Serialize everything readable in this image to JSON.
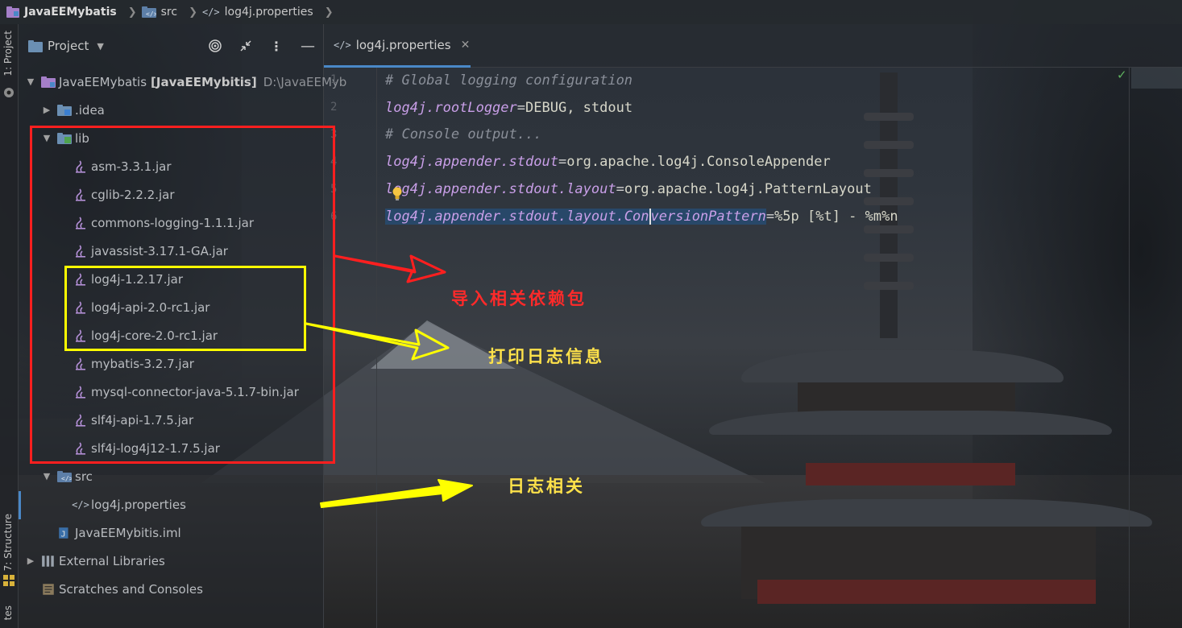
{
  "navbar": {
    "project": "JavaEEMybatis",
    "src": "src",
    "file": "log4j.properties"
  },
  "stripe": {
    "project_label": "1: Project",
    "structure_label": "7: Structure",
    "favorites_label": "tes"
  },
  "panel": {
    "title": "Project"
  },
  "tree": {
    "root": {
      "name": "JavaEEMybatis",
      "module": "[JavaEEMybitis]",
      "path": "D:\\JavaEEMyb"
    },
    "idea": ".idea",
    "lib": "lib",
    "jars": [
      "asm-3.3.1.jar",
      "cglib-2.2.2.jar",
      "commons-logging-1.1.1.jar",
      "javassist-3.17.1-GA.jar",
      "log4j-1.2.17.jar",
      "log4j-api-2.0-rc1.jar",
      "log4j-core-2.0-rc1.jar",
      "mybatis-3.2.7.jar",
      "mysql-connector-java-5.1.7-bin.jar",
      "slf4j-api-1.7.5.jar",
      "slf4j-log4j12-1.7.5.jar"
    ],
    "src": "src",
    "properties": "log4j.properties",
    "iml": "JavaEEMybitis.iml",
    "external": "External Libraries",
    "scratches": "Scratches and Consoles"
  },
  "editor": {
    "tab_label": "log4j.properties",
    "line_numbers": [
      "1",
      "2",
      "3",
      "4",
      "5",
      "6"
    ],
    "lines": {
      "l1": "# Global logging configuration",
      "l2_key": "log4j.rootLogger",
      "l2_val": "DEBUG, stdout",
      "l3": "# Console output...",
      "l4_key": "log4j.appender.stdout",
      "l4_val": "org.apache.log4j.ConsoleAppender",
      "l5_key": "log4j.appender.stdout.layout",
      "l5_val": "org.apache.log4j.PatternLayout",
      "l6_key_a": "log4j.appender.stdout.layout.Con",
      "l6_key_b": "versionPattern",
      "l6_val": "%5p [%t] - %m%n",
      "eq": "="
    }
  },
  "annotations": {
    "import_deps": "导入相关依赖包",
    "print_log": "打印日志信息",
    "log_related": "日志相关"
  },
  "colors": {
    "red_box": "#ff1f1f",
    "yellow_box": "#ffff00",
    "accent": "#4a88c7"
  }
}
